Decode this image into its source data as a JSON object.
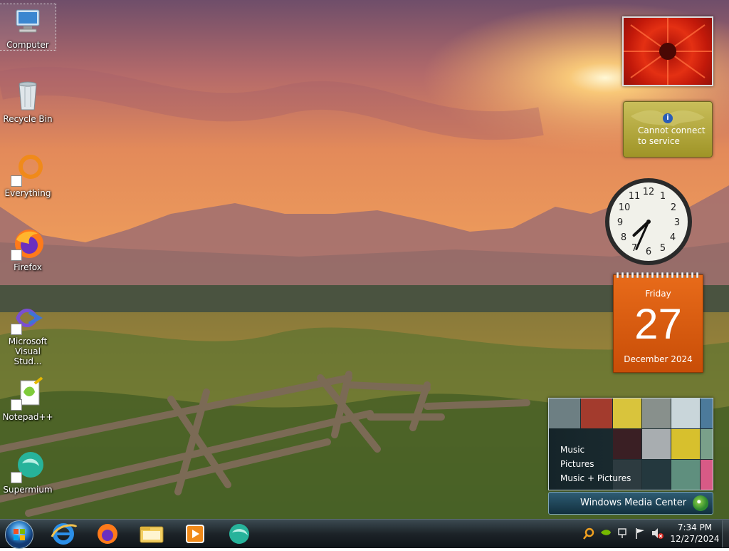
{
  "desktop": {
    "icons": [
      {
        "label": "Computer"
      },
      {
        "label": "Recycle Bin"
      },
      {
        "label": "Everything"
      },
      {
        "label": "Firefox"
      },
      {
        "label": "Microsoft Visual Stud..."
      },
      {
        "label": "Notepad++"
      },
      {
        "label": "Supermium"
      }
    ]
  },
  "gadgets": {
    "weather": {
      "message": "Cannot connect to service"
    },
    "clock": {
      "hour": 7,
      "minute": 34
    },
    "calendar": {
      "weekday": "Friday",
      "day": "27",
      "month_year": "December 2024"
    },
    "media_center": {
      "links": [
        "Music",
        "Pictures",
        "Music + Pictures"
      ],
      "title": "Windows Media Center"
    }
  },
  "taskbar": {
    "pinned": [
      "internet-explorer-icon",
      "firefox-icon",
      "file-explorer-icon",
      "media-player-icon",
      "supermium-icon"
    ],
    "tray_icons": [
      "search-icon",
      "nvidia-icon",
      "network-icon",
      "flag-icon",
      "volume-muted-icon"
    ],
    "time": "7:34 PM",
    "date": "12/27/2024"
  },
  "colors": {
    "calendar_orange": "#d9590e",
    "weather_olive": "#b3a93d",
    "taskbar_dark": "#1c2328"
  }
}
